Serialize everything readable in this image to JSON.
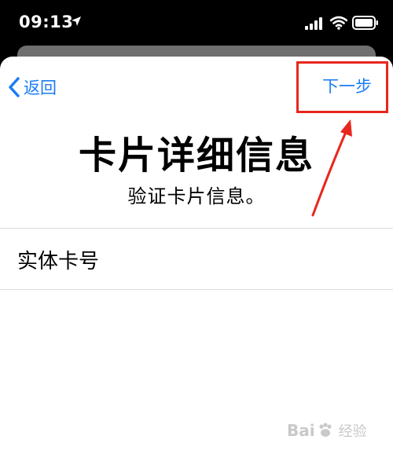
{
  "status_bar": {
    "time": "09:13",
    "icons": [
      "location-arrow-icon",
      "cellular-signal-icon",
      "wifi-icon",
      "battery-icon"
    ]
  },
  "nav": {
    "back_label": "返回",
    "next_label": "下一步"
  },
  "header": {
    "title": "卡片详细信息",
    "subtitle": "验证卡片信息。"
  },
  "form": {
    "card_number_label": "实体卡号"
  },
  "watermark": {
    "brand": "Bai",
    "text": "经验"
  },
  "colors": {
    "accent": "#1a7cf5",
    "annotation_red": "#e8261e",
    "status_bar_bg": "#000000",
    "sheet_bg": "#ffffff"
  }
}
